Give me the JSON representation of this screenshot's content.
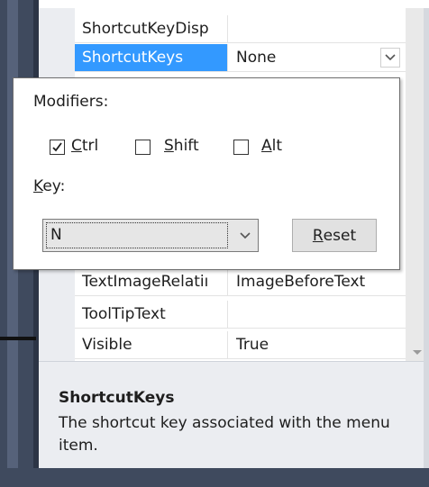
{
  "property_rows": [
    {
      "name": "ShortcutKeyDisp",
      "value": ""
    },
    {
      "name": "ShortcutKeys",
      "value": "None",
      "selected": true
    },
    {
      "name": "TextImageRelatiı",
      "value": "ImageBeforeText"
    },
    {
      "name": "ToolTipText",
      "value": ""
    },
    {
      "name": "Visible",
      "value": "True"
    }
  ],
  "popup": {
    "modifiers_label": "Modifiers:",
    "checkboxes": [
      {
        "label": "Ctrl",
        "mnemonic": "C",
        "rest": "trl",
        "checked": true
      },
      {
        "label": "Shift",
        "mnemonic": "S",
        "rest": "hift",
        "checked": false
      },
      {
        "label": "Alt",
        "mnemonic": "A",
        "rest": "lt",
        "checked": false
      }
    ],
    "key_label_mnemonic": "K",
    "key_label_rest": "ey:",
    "key_value": "N",
    "reset_mnemonic": "R",
    "reset_rest": "eset"
  },
  "description": {
    "title": "ShortcutKeys",
    "text": "The shortcut key associated with the menu item."
  },
  "icons": {
    "dropdown": "chevron-down-icon",
    "check": "checkmark-icon",
    "scroll_down": "scroll-down-arrow-icon"
  }
}
